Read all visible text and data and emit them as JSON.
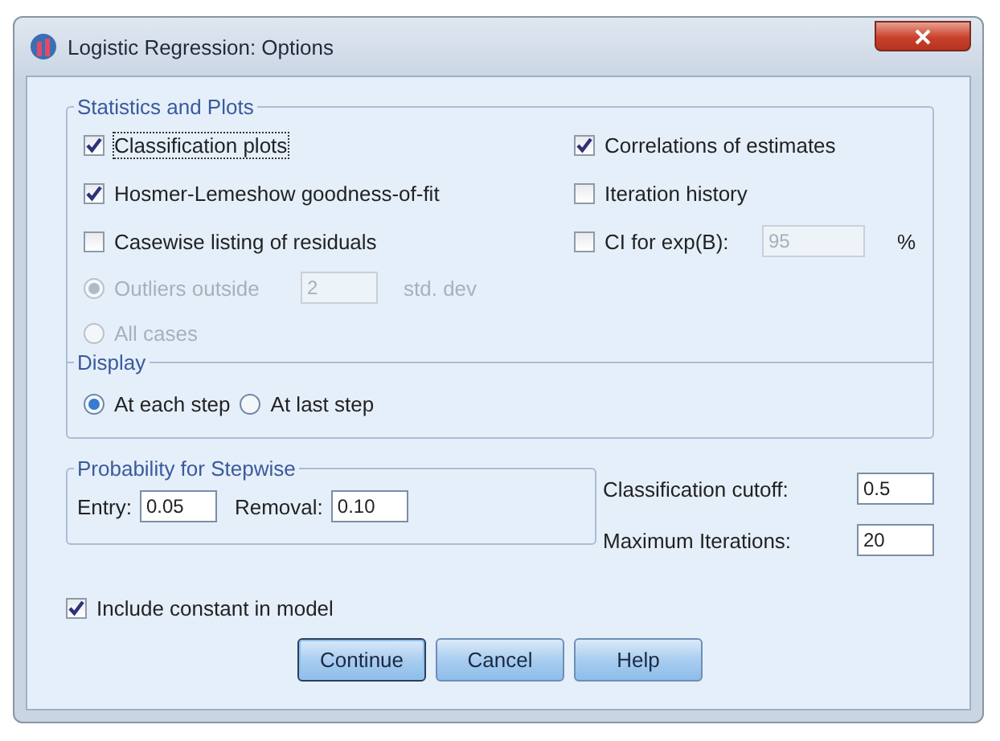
{
  "window": {
    "title": "Logistic Regression: Options"
  },
  "statistics_and_plots": {
    "title": "Statistics and Plots",
    "left_options": [
      {
        "label": "Classification plots",
        "checked": true,
        "focused": true
      },
      {
        "label": "Hosmer-Lemeshow goodness-of-fit",
        "checked": true,
        "focused": false
      },
      {
        "label": "Casewise listing of residuals",
        "checked": false,
        "focused": false
      }
    ],
    "casewise_options": [
      {
        "label": "Outliers outside",
        "selected": true,
        "disabled": true,
        "value": "2",
        "unit": "std. dev"
      },
      {
        "label": "All cases",
        "selected": false,
        "disabled": true
      }
    ],
    "right_options": [
      {
        "label": "Correlations of estimates",
        "checked": true
      },
      {
        "label": "Iteration history",
        "checked": false
      },
      {
        "label": "CI for exp(B):",
        "checked": false,
        "value": "95",
        "value_disabled": true,
        "unit": "%"
      }
    ]
  },
  "display": {
    "title": "Display",
    "options": [
      {
        "label": "At each step",
        "selected": true
      },
      {
        "label": "At last step",
        "selected": false
      }
    ]
  },
  "probability_for_stepwise": {
    "title": "Probability for Stepwise",
    "fields": [
      {
        "label": "Entry:",
        "value": "0.05"
      },
      {
        "label": "Removal:",
        "value": "0.10"
      }
    ]
  },
  "right_fields": [
    {
      "label": "Classification cutoff:",
      "value": "0.5"
    },
    {
      "label": "Maximum Iterations:",
      "value": "20"
    }
  ],
  "include_constant": {
    "label": "Include constant in model",
    "checked": true
  },
  "buttons": [
    {
      "label": "Continue",
      "default": true
    },
    {
      "label": "Cancel",
      "default": false
    },
    {
      "label": "Help",
      "default": false
    }
  ]
}
